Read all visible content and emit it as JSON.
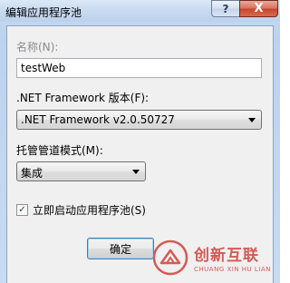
{
  "window": {
    "title": "编辑应用程序池",
    "help_glyph": "?",
    "close_glyph": "X"
  },
  "form": {
    "name_label": "名称(N):",
    "name_value": "testWeb",
    "framework_label": ".NET Framework 版本(F):",
    "framework_value": ".NET Framework v2.0.50727",
    "pipeline_label": "托管管道模式(M):",
    "pipeline_value": "集成",
    "autostart_label": "立即启动应用程序池(S)",
    "autostart_checked": true,
    "check_glyph": "✓",
    "ok_label": "确定"
  },
  "watermark": {
    "brand_cn": "创新互联",
    "brand_en": "CHUANG XIN HU LIAN"
  },
  "colors": {
    "accent": "#3c7fb1",
    "watermark": "#d35a55"
  }
}
